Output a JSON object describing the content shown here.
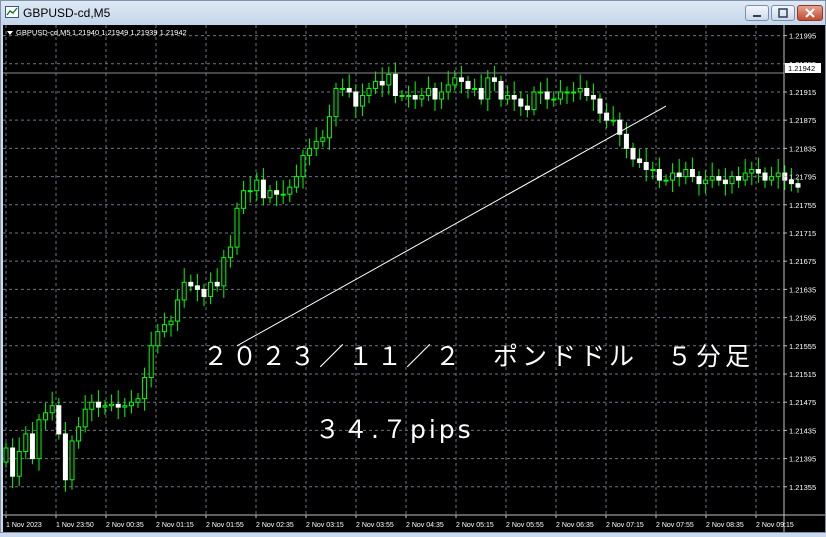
{
  "window": {
    "title": "GBPUSD-cd,M5"
  },
  "chart_data": {
    "type": "candlestick",
    "symbol_header": "GBPUSD-cd,M5",
    "ohlc_header": "1.21940 1.21949 1.21939 1.21942",
    "current_price_label": "1.21942",
    "current_price": 1.21942,
    "ylim": [
      1.21315,
      1.2201
    ],
    "y_ticks": [
      "1.21995",
      "1.21955",
      "1.21915",
      "1.21875",
      "1.21835",
      "1.21795",
      "1.21755",
      "1.21715",
      "1.21675",
      "1.21635",
      "1.21595",
      "1.21555",
      "1.21515",
      "1.21475",
      "1.21435",
      "1.21395",
      "1.21355"
    ],
    "x_ticks": [
      "1 Nov 2023",
      "1 Nov 23:50",
      "2 Nov 00:35",
      "2 Nov 01:15",
      "2 Nov 01:55",
      "2 Nov 02:35",
      "2 Nov 03:15",
      "2 Nov 03:55",
      "2 Nov 04:35",
      "2 Nov 05:15",
      "2 Nov 05:55",
      "2 Nov 06:35",
      "2 Nov 07:15",
      "2 Nov 07:55",
      "2 Nov 08:35",
      "2 Nov 09:15"
    ],
    "grid": true,
    "annotation_title": "２０２３／１１／２　ポンドドル　５分足",
    "annotation_pips": "３４.７pips",
    "trendline": {
      "x1": 35,
      "y1": 1.21555,
      "x2": 100,
      "y2": 1.21895
    },
    "closes": [
      1.2141,
      1.2137,
      1.21405,
      1.2143,
      1.21395,
      1.2145,
      1.2146,
      1.2147,
      1.2143,
      1.21365,
      1.2142,
      1.2144,
      1.21465,
      1.21475,
      1.21468,
      1.2147,
      1.21472,
      1.21468,
      1.2147,
      1.21475,
      1.2148,
      1.2151,
      1.21555,
      1.21575,
      1.21585,
      1.2159,
      1.2162,
      1.21645,
      1.2164,
      1.21635,
      1.21625,
      1.21645,
      1.2164,
      1.2168,
      1.21695,
      1.2175,
      1.21775,
      1.21775,
      1.2179,
      1.21765,
      1.21775,
      1.2177,
      1.2177,
      1.2178,
      1.21795,
      1.21825,
      1.21835,
      1.21845,
      1.2185,
      1.2188,
      1.2192,
      1.2192,
      1.21915,
      1.21895,
      1.2191,
      1.2192,
      1.2193,
      1.21925,
      1.2194,
      1.2191,
      1.2191,
      1.2191,
      1.21905,
      1.2191,
      1.2192,
      1.21905,
      1.21915,
      1.21925,
      1.21935,
      1.2193,
      1.2192,
      1.2192,
      1.21905,
      1.21935,
      1.2193,
      1.21905,
      1.2191,
      1.21905,
      1.21895,
      1.2189,
      1.21915,
      1.21915,
      1.21905,
      1.21905,
      1.21915,
      1.21915,
      1.21915,
      1.2192,
      1.2191,
      1.21905,
      1.21885,
      1.21875,
      1.21875,
      1.21855,
      1.21835,
      1.2182,
      1.21815,
      1.21805,
      1.21805,
      1.2179,
      1.2179,
      1.218,
      1.21795,
      1.21805,
      1.21795,
      1.21785,
      1.2179,
      1.21795,
      1.2179,
      1.21785,
      1.21795,
      1.2179,
      1.218,
      1.21805,
      1.218,
      1.2179,
      1.21795,
      1.218,
      1.2179,
      1.21785,
      1.2178
    ]
  }
}
